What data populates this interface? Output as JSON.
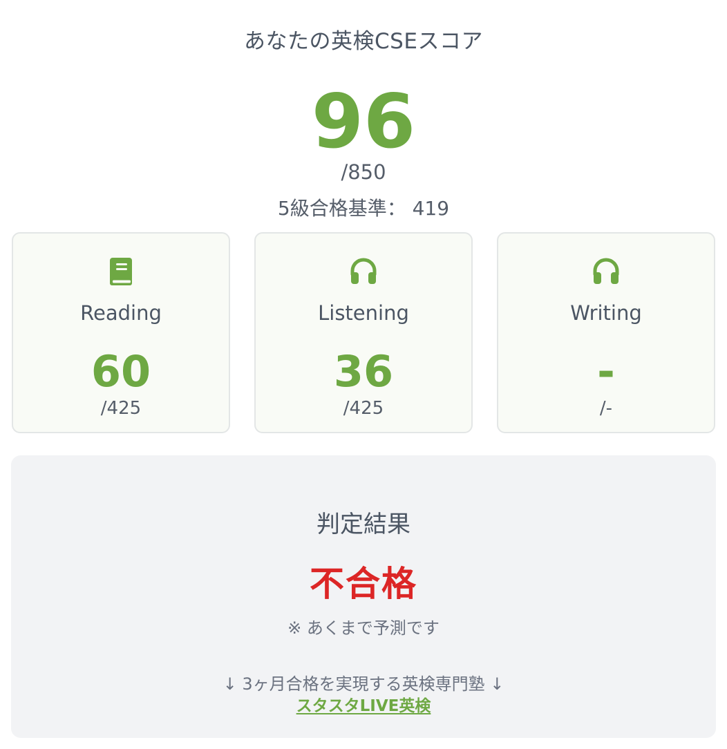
{
  "page": {
    "title": "あなたの英検CSEスコア",
    "accent_color": "#6ea843",
    "fail_color": "#dc2626"
  },
  "total": {
    "score": "96",
    "max": "/850",
    "passline": "5級合格基準： 419"
  },
  "sections": [
    {
      "icon": "book-icon",
      "label": "Reading",
      "score": "60",
      "max": "/425"
    },
    {
      "icon": "headphones-icon",
      "label": "Listening",
      "score": "36",
      "max": "/425"
    },
    {
      "icon": "headphones-icon",
      "label": "Writing",
      "score": "-",
      "max": "/-"
    }
  ],
  "result": {
    "heading": "判定結果",
    "value": "不合格",
    "note": "※ あくまで予測です",
    "promo_text": "↓ 3ヶ月合格を実現する英検専門塾 ↓",
    "promo_link": "スタスタLIVE英検"
  }
}
